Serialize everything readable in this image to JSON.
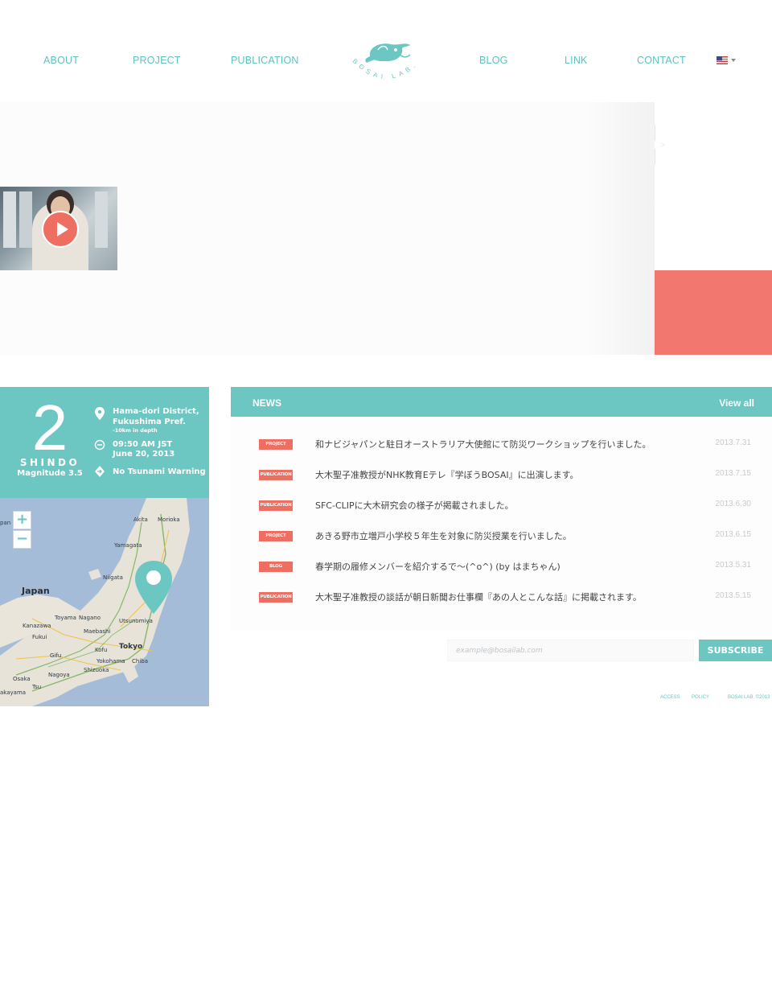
{
  "nav": {
    "left": [
      "ABOUT",
      "PROJECT",
      "PUBLICATION"
    ],
    "right": [
      "BLOG",
      "LINK",
      "CONTACT"
    ],
    "logo_text": "BOSAI LAB.",
    "language": "en-us-flag"
  },
  "quake": {
    "intensity": "2",
    "scale_label": "SHINDO",
    "magnitude": "Magnitude 3.5",
    "location_line1": "Hama-dori District,",
    "location_line2": "Fukushima Pref.",
    "depth": "-10km in depth",
    "time": "09:50 AM JST",
    "date": "June 20, 2013",
    "tsunami": "No Tsunami Warning",
    "icons": [
      "location-pin-icon",
      "clock-icon",
      "tsunami-warning-icon"
    ]
  },
  "map": {
    "zoom_in": "+",
    "zoom_out": "−",
    "labels": {
      "japan": "Japan",
      "akita": "Akita",
      "morioka": "Morioka",
      "yamagata": "Yamagata",
      "niigata": "Niigata",
      "toyama": "Toyama",
      "nagano": "Nagano",
      "kanazawa": "Kanazawa",
      "fukui": "Fukui",
      "utsunomiya": "Utsunomiya",
      "maebashi": "Maebashi",
      "kofu": "Kofu",
      "tokyo": "Tokyo",
      "yokohama": "Yokohama",
      "chiba": "Chiba",
      "gifu": "Gifu",
      "nagoya": "Nagoya",
      "shizuoka": "Shizuoka",
      "osaka": "Osaka",
      "wakayama": "akayama",
      "tsu": "Tsu",
      "ryo": "pan"
    },
    "colors": {
      "sea": "#a5bcd8",
      "land": "#e7e3d8",
      "marker": "#6cc6c1"
    }
  },
  "news": {
    "title": "NEWS",
    "view_all": "View all",
    "items": [
      {
        "tag": "PROJECT",
        "text": "和ナビジャパンと駐日オーストラリア大使館にて防災ワークショップを行いました。",
        "date": "2013.7.31"
      },
      {
        "tag": "PUBLICATION",
        "text": "大木聖子准教授がNHK教育Eテレ『学ぼうBOSAI』に出演します。",
        "date": "2013.7.15"
      },
      {
        "tag": "PUBLICATION",
        "text": "SFC-CLIPに大木研究会の様子が掲載されました。",
        "date": "2013.6.30"
      },
      {
        "tag": "PROJECT",
        "text": "あきる野市立増戸小学校５年生を対象に防災授業を行いました。",
        "date": "2013.6.15"
      },
      {
        "tag": "BLOG",
        "text": "春学期の履修メンバーを紹介するで〜(^o^) (by はまちゃん)",
        "date": "2013.5.31"
      },
      {
        "tag": "PUBLICATION",
        "text": "大木聖子准教授の談話が朝日新聞お仕事欄『あの人とこんな話』に掲載されます。",
        "date": "2013.5.15"
      }
    ]
  },
  "subscribe": {
    "placeholder": "example@bosailab.com",
    "button": "SUBSCRIBE"
  },
  "footer": {
    "access": "ACCESS",
    "policy": "POLICY",
    "copyright": "BOSAI LAB. ©2013"
  },
  "colors": {
    "accent": "#6cc6c1",
    "coral": "#ee6e62"
  }
}
